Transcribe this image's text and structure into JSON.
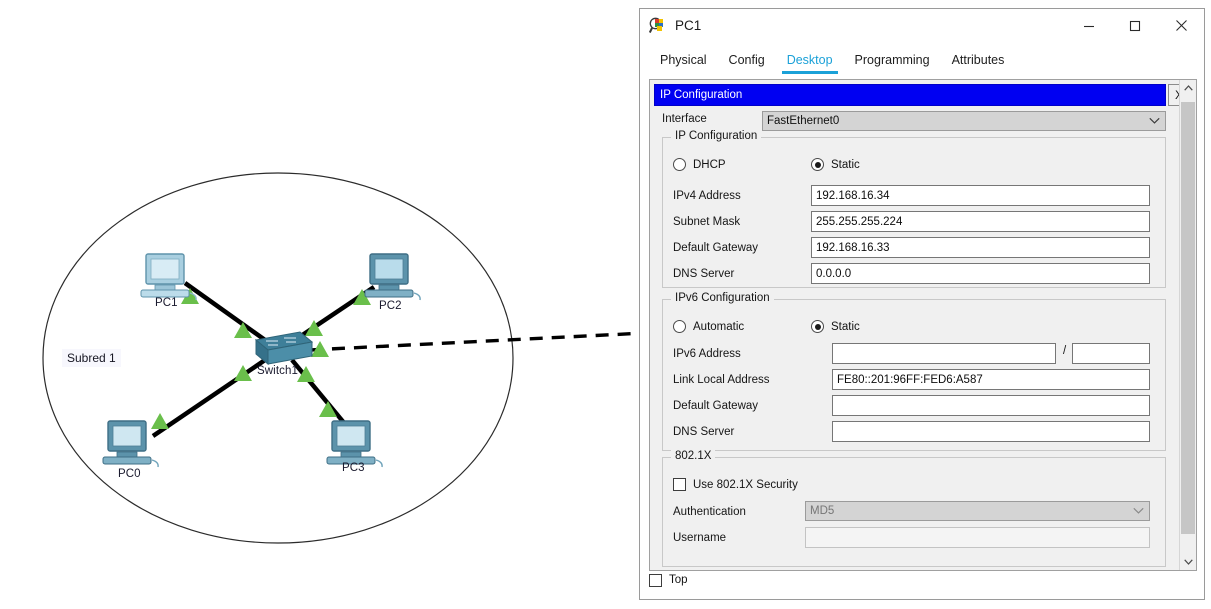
{
  "window": {
    "title": "PC1",
    "icon": "packet-tracer-icon",
    "minimize": "—",
    "maximize": "□",
    "close": "✕"
  },
  "tabs": [
    {
      "label": "Physical",
      "active": false
    },
    {
      "label": "Config",
      "active": false
    },
    {
      "label": "Desktop",
      "active": true
    },
    {
      "label": "Programming",
      "active": false
    },
    {
      "label": "Attributes",
      "active": false
    }
  ],
  "ip_window": {
    "title": "IP Configuration",
    "close_label": "X",
    "accent_blue": "#0000f2",
    "interface": {
      "label": "Interface",
      "value": "FastEthernet0"
    },
    "ipv4": {
      "group_title": "IP Configuration",
      "dhcp_label": "DHCP",
      "dhcp_selected": false,
      "static_label": "Static",
      "static_selected": true,
      "fields": [
        {
          "label": "IPv4 Address",
          "value": "192.168.16.34"
        },
        {
          "label": "Subnet Mask",
          "value": "255.255.255.224"
        },
        {
          "label": "Default Gateway",
          "value": "192.168.16.33"
        },
        {
          "label": "DNS Server",
          "value": "0.0.0.0"
        }
      ]
    },
    "ipv6": {
      "group_title": "IPv6 Configuration",
      "automatic_label": "Automatic",
      "automatic_selected": false,
      "static_label": "Static",
      "static_selected": true,
      "address_label": "IPv6 Address",
      "address_value": "",
      "prefix_separator": "/",
      "prefix_value": "",
      "fields": [
        {
          "label": "Link Local Address",
          "value": "FE80::201:96FF:FED6:A587"
        },
        {
          "label": "Default Gateway",
          "value": ""
        },
        {
          "label": "DNS Server",
          "value": ""
        }
      ]
    },
    "dot1x": {
      "group_title": "802.1X",
      "use_security_label": "Use 802.1X Security",
      "use_security_checked": false,
      "authentication_label": "Authentication",
      "authentication_value": "MD5",
      "username_label": "Username",
      "username_value": ""
    }
  },
  "footer": {
    "top_label": "Top",
    "top_checked": false
  },
  "topology": {
    "subnet_label": "Subred 1",
    "nodes": [
      {
        "name": "PC1",
        "label": "PC1",
        "type": "pc"
      },
      {
        "name": "PC2",
        "label": "PC2",
        "type": "pc"
      },
      {
        "name": "PC0",
        "label": "PC0",
        "type": "pc"
      },
      {
        "name": "PC3",
        "label": "PC3",
        "type": "pc"
      },
      {
        "name": "Switch1",
        "label": "Switch1",
        "type": "switch"
      }
    ],
    "link_color": "#000000",
    "status_marker_color": "#6abf4b",
    "ellipse_color": "#2b2b2b"
  }
}
